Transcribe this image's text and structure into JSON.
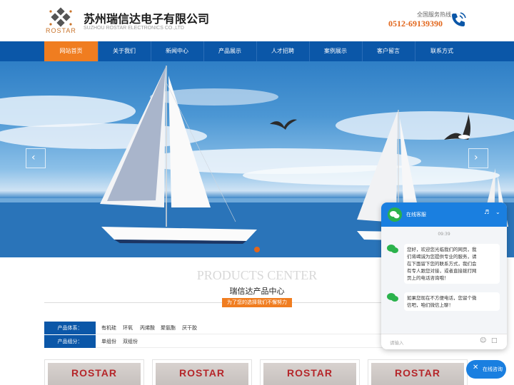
{
  "header": {
    "logo_text": "ROSTAR",
    "company_cn": "苏州瑞信达电子有限公司",
    "company_en": "SUZHOU ROSTAR ELECTRONICS CO.,LTD",
    "hotline_label": "全国服务热线",
    "hotline_number": "0512-69139390",
    "phone_icon": "phone-icon"
  },
  "nav": {
    "items": [
      {
        "label": "网站首页",
        "active": true
      },
      {
        "label": "关于我们",
        "active": false
      },
      {
        "label": "新闻中心",
        "active": false
      },
      {
        "label": "产品展示",
        "active": false
      },
      {
        "label": "人才招聘",
        "active": false
      },
      {
        "label": "案例展示",
        "active": false
      },
      {
        "label": "客户留言",
        "active": false
      },
      {
        "label": "联系方式",
        "active": false
      }
    ]
  },
  "banner": {
    "prev_icon": "arrow-left-icon",
    "next_icon": "arrow-right-icon"
  },
  "products": {
    "title_en": "PRODUCTS CENTER",
    "title_cn": "瑞信达产品中心",
    "tagline": "为了您的选择我们不懈努力",
    "filters": [
      {
        "head": "产品体系：",
        "options": [
          "有机硅",
          "环氧",
          "丙烯酸",
          "聚氨酯",
          "厌干胶"
        ]
      },
      {
        "head": "产品组分：",
        "options": [
          "单组份",
          "双组份"
        ]
      }
    ],
    "cards": [
      {
        "brand": "ROSTAR"
      },
      {
        "brand": "ROSTAR"
      },
      {
        "brand": "ROSTAR"
      },
      {
        "brand": "ROSTAR"
      }
    ]
  },
  "chat": {
    "title": "在线客服",
    "time": "09:39",
    "messages": [
      {
        "lines": [
          "您好，欢迎您光临我们的网页，我",
          "们将竭诚为您提供专业的服务，请",
          "在下面留下您的联系方式，我们会",
          "有专人跟您对接，或者直接拨打网",
          "页上的电话咨询哦！"
        ]
      },
      {
        "lines": [
          "如果您现在不方便电话，您留个微",
          "信吧，咱们微信上聊！"
        ]
      }
    ],
    "input_placeholder": "请输入",
    "accent": "#1a7fe0"
  },
  "consult_button": {
    "label": "在线咨询"
  },
  "colors": {
    "nav_bg": "#0b57a8",
    "nav_active": "#f07d20",
    "hotline": "#e2661b"
  }
}
